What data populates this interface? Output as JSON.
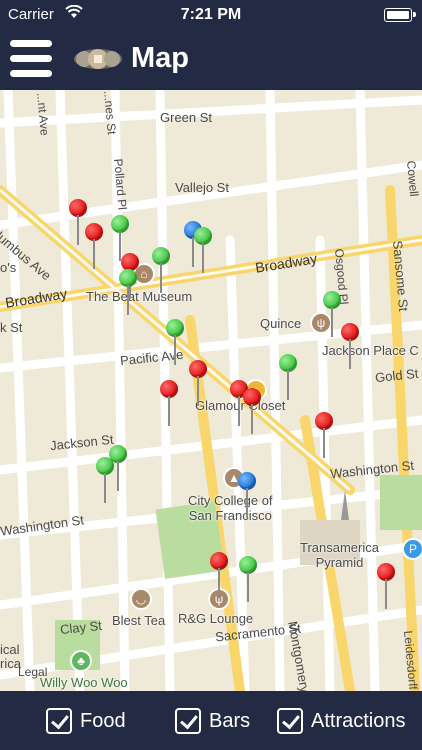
{
  "status_bar": {
    "carrier": "Carrier",
    "time": "7:21 PM"
  },
  "nav": {
    "title": "Map"
  },
  "map": {
    "streets": {
      "green_st": "Green St",
      "vallejo_st": "Vallejo St",
      "columbus_ave": "Columbus Ave",
      "broadway_right": "Broadway",
      "broadway_left": "Broadway",
      "pacific_ave": "Pacific Ave",
      "gold_st": "Gold St",
      "jackson_st": "Jackson St",
      "washington_st_right": "Washington St",
      "washington_st_left": "Washington St",
      "clay_st": "Clay St",
      "sacramento_st": "Sacramento St",
      "montgomery_st": "Montgomery St",
      "sansome_st": "Sansome St",
      "osgood_pl": "Osgood Pl",
      "pollard_pl": "Pollard Pl",
      "kearny_ave": "...nt Ave",
      "himes_st": "...nes St",
      "cowell": "Cowell",
      "leidesdorff": "Leidesdorff",
      "ks": "k St",
      "os": "o's",
      "ical": "ical",
      "rica": "rica"
    },
    "pois": {
      "beat_museum": "The Beat Museum",
      "quince": "Quince",
      "jackson_place": "Jackson Place C",
      "glamour_closet": "Glamour Closet",
      "city_college": "City College of\nSan Francisco",
      "transamerica": "Transamerica\nPyramid",
      "blest_tea": "Blest Tea",
      "rg_lounge": "R&G Lounge",
      "willy_woo_woo": "Willy Woo Woo",
      "legal": "Legal"
    }
  },
  "filters": [
    {
      "label": "Food",
      "checked": true
    },
    {
      "label": "Bars",
      "checked": true
    },
    {
      "label": "Attractions",
      "checked": true
    }
  ],
  "colors": {
    "header_bg": "#222a44",
    "map_bg": "#efe9d8",
    "pin_red": "#e01515",
    "pin_green": "#3ec33e",
    "pin_blue": "#1e74d8"
  }
}
